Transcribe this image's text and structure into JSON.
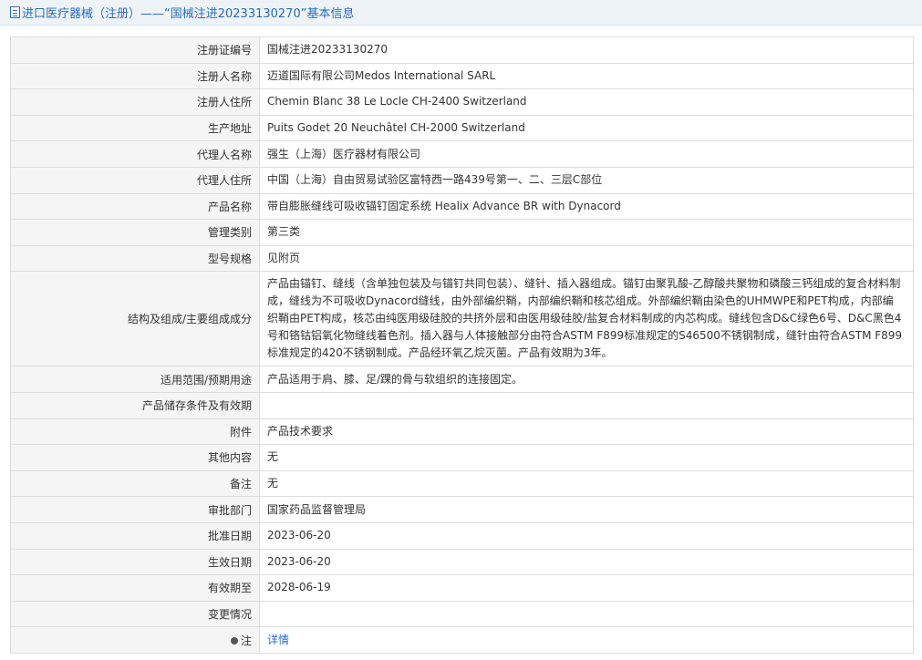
{
  "header": {
    "title": "进口医疗器械（注册）——“国械注进20233130270”基本信息"
  },
  "rows": [
    {
      "label": "注册证编号",
      "value": "国械注进20233130270"
    },
    {
      "label": "注册人名称",
      "value": "迈道国际有限公司Medos International SARL"
    },
    {
      "label": "注册人住所",
      "value": "Chemin Blanc 38 Le Locle CH-2400 Switzerland"
    },
    {
      "label": "生产地址",
      "value": "Puits Godet 20 Neuchâtel CH-2000 Switzerland"
    },
    {
      "label": "代理人名称",
      "value": "强生（上海）医疗器材有限公司"
    },
    {
      "label": "代理人住所",
      "value": "中国（上海）自由贸易试验区富特西一路439号第一、二、三层C部位"
    },
    {
      "label": "产品名称",
      "value": "带自膨胀缝线可吸收锚钉固定系统 Healix Advance BR with Dynacord"
    },
    {
      "label": "管理类别",
      "value": "第三类"
    },
    {
      "label": "型号规格",
      "value": "见附页"
    },
    {
      "label": "结构及组成/主要组成成分",
      "value": "产品由锚钉、缝线（含单独包装及与锚钉共同包装）、缝针、插入器组成。锚钉由聚乳酸-乙醇酸共聚物和磷酸三钙组成的复合材料制成，缝线为不可吸收Dynacord缝线，由外部编织鞘，内部编织鞘和核芯组成。外部编织鞘由染色的UHMWPE和PET构成，内部编织鞘由PET构成，核芯由纯医用级硅胶的共挤外层和由医用级硅胶/盐复合材料制成的内芯构成。缝线包含D&C绿色6号、D&C黑色4号和铬钴铝氧化物缝线着色剂。插入器与人体接触部分由符合ASTM F899标准规定的S46500不锈钢制成，缝针由符合ASTM F899标准规定的420不锈钢制成。产品经环氧乙烷灭菌。产品有效期为3年。"
    },
    {
      "label": "适用范围/预期用途",
      "value": "产品适用于肩、膝、足/踝的骨与软组织的连接固定。"
    },
    {
      "label": "产品储存条件及有效期",
      "value": ""
    },
    {
      "label": "附件",
      "value": "产品技术要求"
    },
    {
      "label": "其他内容",
      "value": "无"
    },
    {
      "label": "备注",
      "value": "无"
    },
    {
      "label": "审批部门",
      "value": "国家药品监督管理局"
    },
    {
      "label": "批准日期",
      "value": "2023-06-20"
    },
    {
      "label": "生效日期",
      "value": "2023-06-20"
    },
    {
      "label": "有效期至",
      "value": "2028-06-19"
    },
    {
      "label": "变更情况",
      "value": ""
    }
  ],
  "note": {
    "label": "注",
    "link_text": "详情"
  }
}
